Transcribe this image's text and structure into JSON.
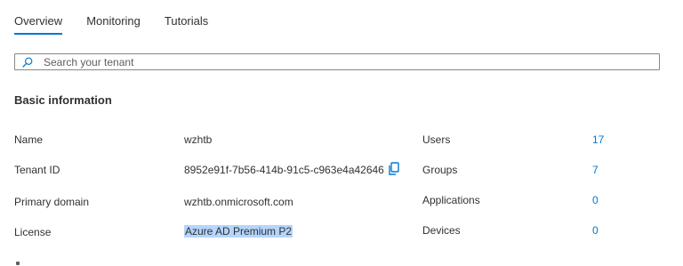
{
  "tabs": [
    {
      "label": "Overview",
      "active": true
    },
    {
      "label": "Monitoring",
      "active": false
    },
    {
      "label": "Tutorials",
      "active": false
    }
  ],
  "search": {
    "placeholder": "Search your tenant",
    "value": "",
    "icon": "search-icon"
  },
  "basic_info": {
    "title": "Basic information",
    "properties": {
      "name": {
        "label": "Name",
        "value": "wzhtb"
      },
      "tenant_id": {
        "label": "Tenant ID",
        "value": "8952e91f-7b56-414b-91c5-c963e4a42646",
        "icon": "copy-icon"
      },
      "primary_domain": {
        "label": "Primary domain",
        "value": "wzhtb.onmicrosoft.com"
      },
      "license": {
        "label": "License",
        "value": "Azure AD Premium P2",
        "selected": true
      }
    },
    "stats": {
      "users": {
        "label": "Users",
        "value": "17"
      },
      "groups": {
        "label": "Groups",
        "value": "7"
      },
      "applications": {
        "label": "Applications",
        "value": "0"
      },
      "devices": {
        "label": "Devices",
        "value": "0"
      }
    }
  },
  "colors": {
    "accent": "#0078d4",
    "text": "#323130",
    "selection": "#b4d5fe",
    "border": "#8a8886"
  }
}
